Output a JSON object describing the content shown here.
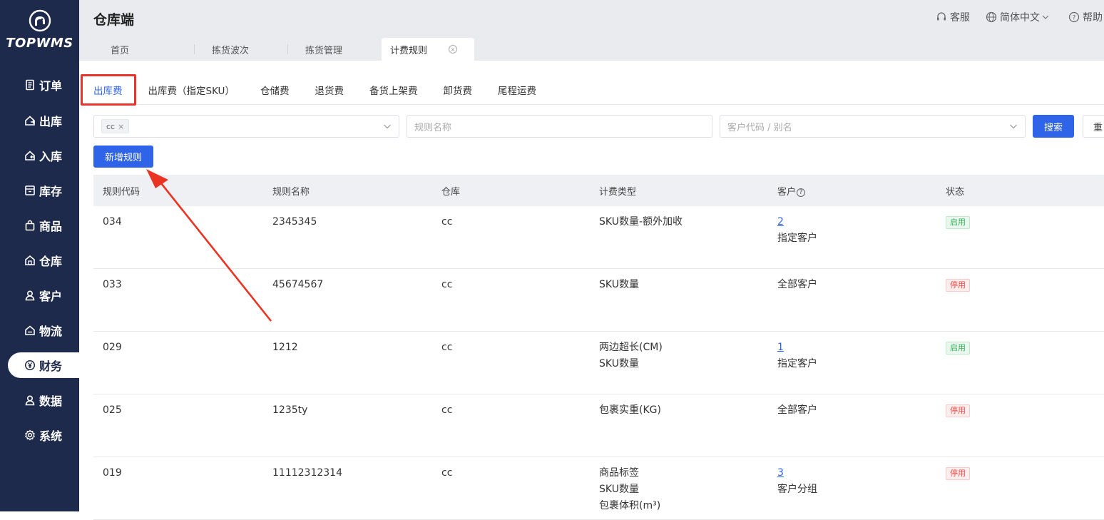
{
  "sidebar": {
    "brand": "TOPWMS",
    "items": [
      {
        "label": "订单",
        "icon": "document-icon"
      },
      {
        "label": "出库",
        "icon": "outbound-icon"
      },
      {
        "label": "入库",
        "icon": "inbound-icon"
      },
      {
        "label": "库存",
        "icon": "inventory-box-icon"
      },
      {
        "label": "商品",
        "icon": "shopping-bag-icon"
      },
      {
        "label": "仓库",
        "icon": "warehouse-icon"
      },
      {
        "label": "客户",
        "icon": "user-icon"
      },
      {
        "label": "物流",
        "icon": "logistics-icon"
      },
      {
        "label": "财务",
        "icon": "yen-coin-icon"
      },
      {
        "label": "数据",
        "icon": "data-user-icon"
      },
      {
        "label": "系统",
        "icon": "gear-icon"
      }
    ],
    "active_index": 8
  },
  "header": {
    "title": "仓库端",
    "tools": {
      "service": "客服",
      "language": "简体中文",
      "help": "帮助"
    }
  },
  "tabs": [
    "首页",
    "拣货波次",
    "拣货管理",
    "计费规则"
  ],
  "subtabs": [
    "出库费",
    "出库费（指定SKU）",
    "仓储费",
    "退货费",
    "备货上架费",
    "卸货费",
    "尾程运费"
  ],
  "filters": {
    "warehouse_chip": "cc",
    "rule_name_placeholder": "规则名称",
    "customer_placeholder": "客户代码 / 别名",
    "search_label": "搜索",
    "reset_label": "重",
    "add_rule_label": "新增规则"
  },
  "table": {
    "headers": [
      "规则代码",
      "规则名称",
      "仓库",
      "计费类型",
      "客户",
      "状态"
    ],
    "rows": [
      {
        "code": "034",
        "name": "2345345",
        "warehouse": "cc",
        "types": [
          "SKU数量-额外加收"
        ],
        "cust_count": "2",
        "cust_text": "指定客户",
        "status": "启用",
        "status_on": true
      },
      {
        "code": "033",
        "name": "45674567",
        "warehouse": "cc",
        "types": [
          "SKU数量"
        ],
        "cust_count": "",
        "cust_text": "全部客户",
        "status": "停用",
        "status_on": false
      },
      {
        "code": "029",
        "name": "1212",
        "warehouse": "cc",
        "types": [
          "两边超长(CM)",
          "SKU数量"
        ],
        "cust_count": "1",
        "cust_text": "指定客户",
        "status": "启用",
        "status_on": true
      },
      {
        "code": "025",
        "name": "1235ty",
        "warehouse": "cc",
        "types": [
          "包裹实重(KG)"
        ],
        "cust_count": "",
        "cust_text": "全部客户",
        "status": "停用",
        "status_on": false
      },
      {
        "code": "019",
        "name": "11112312314",
        "warehouse": "cc",
        "types": [
          "商品标签",
          "SKU数量",
          "包裹体积(m³)"
        ],
        "cust_count": "3",
        "cust_text": "客户分组",
        "status": "停用",
        "status_on": false
      }
    ]
  },
  "colors": {
    "sidebar": "#1e2a4c",
    "primary": "#2f64e8",
    "highlight": "#e8352b"
  }
}
